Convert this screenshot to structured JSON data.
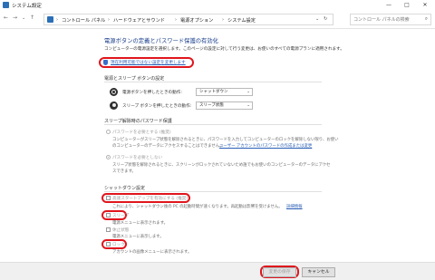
{
  "window": {
    "title": "システム設定",
    "controls": [
      "—",
      "□",
      "✕"
    ]
  },
  "address_bar": {
    "breadcrumbs": [
      "コントロール パネル",
      "ハードウェアとサウンド",
      "電源オプション",
      "システム設定"
    ],
    "search_placeholder": "コントロール パネルの検索"
  },
  "main": {
    "heading": "電源ボタンの定義とパスワード保護の有効化",
    "description": "コンピューターの電源設定を選択します。このページの設定に対して行う変更は、お使いのすべての電源プランに適用されます。",
    "shield_link": "現在利用可能ではない設定を変更します",
    "power_section": {
      "title": "電源とスリープ ボタンの設定",
      "rows": [
        {
          "label": "電源ボタンを押したときの動作:",
          "value": "シャットダウン"
        },
        {
          "label": "スリープ ボタンを押したときの動作:",
          "value": "スリープ状態"
        }
      ]
    },
    "password_section": {
      "title": "スリープ解除時のパスワード保護",
      "options": [
        {
          "label": "パスワードを必要とする (推奨)",
          "desc1": "コンピューターがスリープ状態を解除されるときに、パスワードを入力してコンピューターのロックを解除しない限り、お使い",
          "desc2": "のコンピューターのデータにアクセスすることはできません。",
          "link": "ユーザー アカウントのパスワードの作成または変更"
        },
        {
          "label": "パスワードを必要としない",
          "desc1": "スリープ状態を解除されるときに、スクリーンがロックされていないため誰でもお使いのコンピューターのデータにアクセ",
          "desc2": "スできます。"
        }
      ]
    },
    "shutdown_section": {
      "title": "シャットダウン設定",
      "items": [
        {
          "label": "高速スタートアップを有効にする (推奨)",
          "desc": "これにより、シャットダウン後の PC の起動時間が速くなります。再起動は影響を受けません。",
          "link": "詳細情報"
        },
        {
          "label": "スリープ",
          "desc": "電源メニューに表示されます。"
        },
        {
          "label": "休止状態",
          "desc": "電源メニューに表示します。"
        },
        {
          "label": "ロック",
          "desc": "アカウントの画像メニューに表示されます。"
        }
      ]
    }
  },
  "footer": {
    "save_label": "変更の保存",
    "cancel_label": "キャンセル"
  },
  "colors": {
    "heading": "#1a3e8c",
    "highlight": "#e0161d",
    "link": "#2a5fb6"
  },
  "icons": {
    "shield": "uac-shield-icon",
    "power": "power-button-icon",
    "sleep": "sleep-button-icon"
  }
}
